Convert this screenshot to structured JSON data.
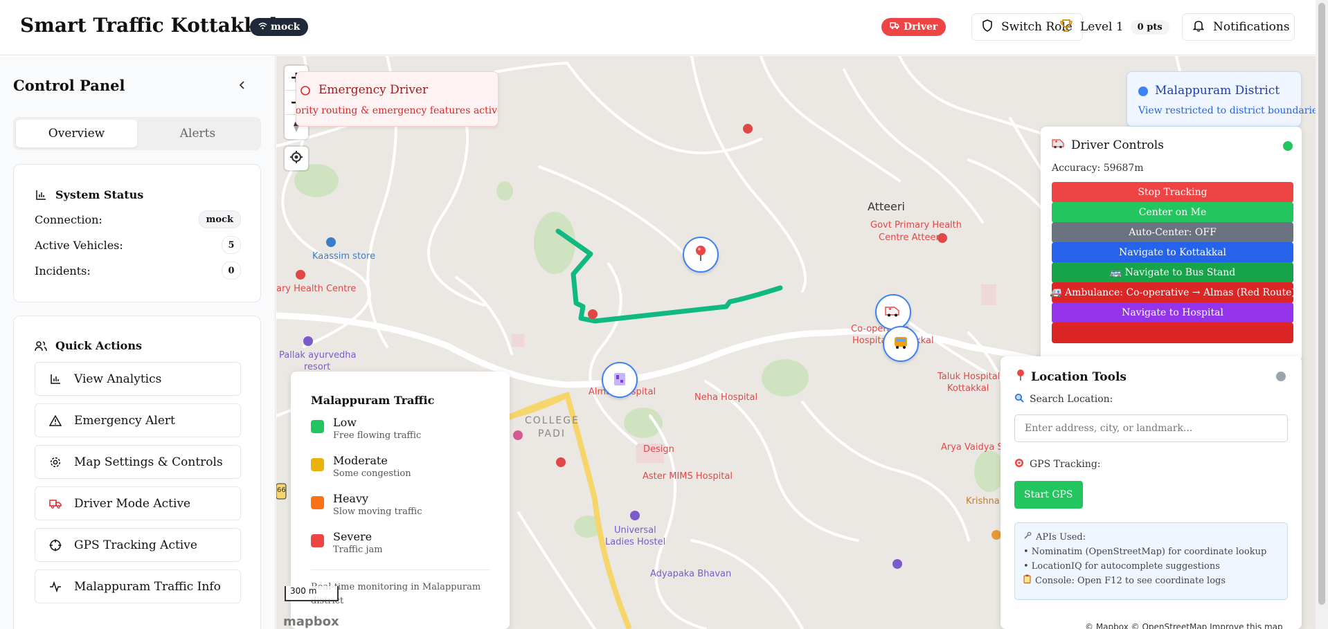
{
  "header": {
    "title": "Smart Traffic Kottakkal",
    "connection_pill": "mock",
    "role_pill": "Driver",
    "switch_role": "Switch Role",
    "level": "Level 1",
    "points": "0 pts",
    "notifications": "Notifications"
  },
  "sidebar": {
    "title": "Control Panel",
    "tabs": [
      {
        "label": "Overview"
      },
      {
        "label": "Alerts"
      }
    ],
    "system_status": {
      "heading": "System Status",
      "rows": [
        {
          "label": "Connection:",
          "value": "mock"
        },
        {
          "label": "Active Vehicles:",
          "value": "5"
        },
        {
          "label": "Incidents:",
          "value": "0"
        }
      ]
    },
    "quick_actions": {
      "heading": "Quick Actions",
      "items": [
        {
          "label": "View Analytics",
          "icon": "bar-chart-icon"
        },
        {
          "label": "Emergency Alert",
          "icon": "warning-icon"
        },
        {
          "label": "Map Settings & Controls",
          "icon": "gear-icon"
        },
        {
          "label": "Driver Mode Active",
          "icon": "truck-icon"
        },
        {
          "label": "GPS Tracking Active",
          "icon": "crosshair-icon"
        },
        {
          "label": "Malappuram Traffic Info",
          "icon": "activity-icon"
        }
      ]
    }
  },
  "map": {
    "emergency": {
      "title": "Emergency Driver",
      "subtitle": "Priority routing & emergency features active"
    },
    "district": {
      "title": "Malappuram District",
      "subtitle": "View restricted to district boundaries"
    },
    "labels": {
      "atteeri": "Atteeri",
      "govt_phc": "Govt Primary Health",
      "govt_phc_2": "Centre Atteeri",
      "kaassim": "Kaassim store",
      "phc_left": "ary Health Centre",
      "pallak": "Pallak ayurvedha",
      "pallak_2": "resort",
      "almas": "Almas Hospital",
      "neha": "Neha Hospital",
      "college": "COLLEGE",
      "college_2": "PADI",
      "design": "Design",
      "aster": "Aster MIMS Hospital",
      "universal": "Universal",
      "universal_2": "Ladies Hostel",
      "adyapaka": "Adyapaka Bhavan",
      "coop": "Co-operative",
      "coop_2": "Hospital Kottakkal",
      "taluk": "Taluk Hospital",
      "taluk_2": "Kottakkal",
      "arya": "Arya Vaidya Sala",
      "krishna": "Krishna",
      "nh": "66"
    },
    "scale": "300 m",
    "logo": "mapbox",
    "attribution": "© Mapbox © OpenStreetMap Improve this map"
  },
  "driver_controls": {
    "title": "Driver Controls",
    "accuracy": "Accuracy: 59687m",
    "buttons": [
      {
        "label": "Stop Tracking",
        "color": "#ef4444"
      },
      {
        "label": "Center on Me",
        "color": "#22c55e"
      },
      {
        "label": "Auto-Center: OFF",
        "color": "#6b7280"
      },
      {
        "label": "Navigate to Kottakkal",
        "color": "#2563eb"
      },
      {
        "label": "🚌 Navigate to Bus Stand",
        "color": "#16a34a"
      },
      {
        "label": "🚑 Ambulance: Co-operative → Almas (Red Route)",
        "color": "#dc2626"
      },
      {
        "label": "Navigate to Hospital",
        "color": "#9333ea"
      }
    ]
  },
  "location_tools": {
    "title": "Location Tools",
    "search_label": "Search Location:",
    "search_placeholder": "Enter address, city, or landmark...",
    "gps_label": "GPS Tracking:",
    "gps_button": "Start GPS",
    "apis_heading": "APIs Used:",
    "apis": [
      "• Nominatim (OpenStreetMap) for coordinate lookup",
      "• LocationIQ for autocomplete suggestions"
    ],
    "console_note": "Console: Open F12 to see coordinate logs"
  },
  "legend": {
    "title": "Malappuram Traffic",
    "items": [
      {
        "name": "Low",
        "desc": "Free flowing traffic",
        "color": "#22c55e"
      },
      {
        "name": "Moderate",
        "desc": "Some congestion",
        "color": "#eab308"
      },
      {
        "name": "Heavy",
        "desc": "Slow moving traffic",
        "color": "#f97316"
      },
      {
        "name": "Severe",
        "desc": "Traffic jam",
        "color": "#ef4444"
      }
    ],
    "footer": "Real-time monitoring in Malappuram district"
  }
}
